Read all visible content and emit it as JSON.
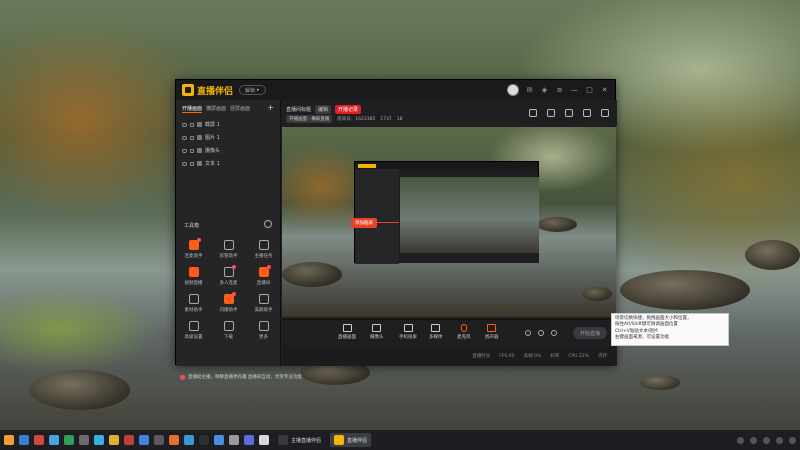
{
  "app": {
    "brand": "直播伴侣",
    "pill_label": "解锁",
    "window_buttons": [
      "—",
      "□",
      "✕"
    ]
  },
  "sidebar": {
    "tabs": [
      {
        "label": "开播画面",
        "active": true
      },
      {
        "label": "横屏画面",
        "active": false
      },
      {
        "label": "竖屏画面",
        "active": false
      }
    ],
    "add_label": "+",
    "sources": [
      {
        "label": "截屏 1"
      },
      {
        "label": "图片 1"
      },
      {
        "label": "摄像头"
      },
      {
        "label": "文本 1"
      }
    ],
    "tools_title": "工具箱",
    "tools": [
      {
        "label": "连麦助手",
        "icon": "mic-link-icon",
        "orange": true,
        "badge": true
      },
      {
        "label": "房管助手",
        "icon": "person-icon",
        "orange": false,
        "badge": false
      },
      {
        "label": "主播任务",
        "icon": "gift-icon",
        "orange": false,
        "badge": false
      },
      {
        "label": "视频直播",
        "icon": "video-live-icon",
        "orange": true,
        "badge": false
      },
      {
        "label": "多人连麦",
        "icon": "multi-user-icon",
        "orange": false,
        "badge": true
      },
      {
        "label": "直播间",
        "icon": "live-room-icon",
        "orange": true,
        "badge": true
      },
      {
        "label": "素材助手",
        "icon": "upload-icon",
        "orange": false,
        "badge": false
      },
      {
        "label": "闪播助手",
        "icon": "flash-icon",
        "orange": true,
        "badge": true
      },
      {
        "label": "美颜助手",
        "icon": "beauty-icon",
        "orange": false,
        "badge": false
      },
      {
        "label": "高级设置",
        "icon": "settings-icon",
        "orange": false,
        "badge": false
      },
      {
        "label": "下载",
        "icon": "download-icon",
        "orange": false,
        "badge": false
      },
      {
        "label": "更多",
        "icon": "more-icon",
        "orange": false,
        "badge": false
      }
    ],
    "notice": "直播助主播，畅聊直播更有趣 直播间互动，享受专业功能"
  },
  "header": {
    "room_title": "直播间标题",
    "btn_edit": "编辑",
    "btn_record": "开播记录",
    "meta": [
      "开播画面 · 横屏直播",
      "房间号：1623385",
      "1737",
      "18"
    ]
  },
  "preview": {
    "tooltip": "添加截屏"
  },
  "controls": [
    {
      "label": "直播画面",
      "icon": "screen-icon"
    },
    {
      "label": "摄像头",
      "icon": "camera-icon"
    },
    {
      "label": "手机投屏",
      "icon": "phone-cast-icon"
    },
    {
      "label": "多媒体",
      "icon": "media-icon"
    },
    {
      "label": "麦克风",
      "icon": "mic-icon"
    },
    {
      "label": "扬声器",
      "icon": "speaker-icon"
    }
  ],
  "start_button": "开始直播",
  "status": [
    "直播时长",
    "FPS:60",
    "丢帧:0%",
    "码率",
    "CPU:22%",
    "内存"
  ],
  "callout_lines": [
    "场景切换快捷，拖拽画面大小和位置，",
    "按住Alt/Shift键可微调画面位置",
    "Ctrl+V粘贴文本/图片",
    "右键画面来源，可设置功能"
  ],
  "taskbar": {
    "apps": [
      {
        "label": "主播直播伴侣",
        "active": false
      },
      {
        "label": "直播伴侣",
        "active": true
      }
    ]
  },
  "colors": {
    "accent": "#ff5c1a",
    "brand": "#f5b400",
    "record_red": "#e02020"
  }
}
